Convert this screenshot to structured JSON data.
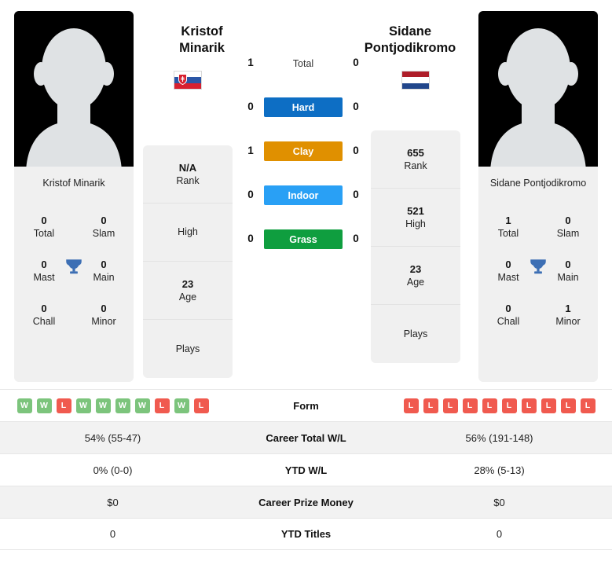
{
  "players": {
    "left": {
      "first_name": "Kristof",
      "last_name": "Minarik",
      "full_name": "Kristof Minarik",
      "photo_caption": "Kristof Minarik",
      "flag_name": "slovakia-flag",
      "flag_colors": [
        "#ffffff",
        "#2b56a6",
        "#d7202f"
      ],
      "trophies": {
        "total_value": "0",
        "total_label": "Total",
        "slam_value": "0",
        "slam_label": "Slam",
        "mast_value": "0",
        "mast_label": "Mast",
        "main_value": "0",
        "main_label": "Main",
        "chall_value": "0",
        "chall_label": "Chall",
        "minor_value": "0",
        "minor_label": "Minor"
      },
      "info": [
        {
          "value": "N/A",
          "label": "Rank"
        },
        {
          "value": "",
          "label": "High"
        },
        {
          "value": "23",
          "label": "Age"
        },
        {
          "value": "",
          "label": "Plays"
        }
      ],
      "form": [
        "W",
        "W",
        "L",
        "W",
        "W",
        "W",
        "W",
        "L",
        "W",
        "L"
      ],
      "career_total_wl": "54% (55-47)",
      "ytd_wl": "0% (0-0)",
      "career_prize_money": "$0",
      "ytd_titles": "0"
    },
    "right": {
      "first_name": "Sidane",
      "last_name": "Pontjodikromo",
      "full_name": "Sidane Pontjodikromo",
      "photo_caption": "Sidane Pontjodikromo",
      "flag_name": "netherlands-flag",
      "flag_colors": [
        "#ae1c28",
        "#ffffff",
        "#21468b"
      ],
      "trophies": {
        "total_value": "1",
        "total_label": "Total",
        "slam_value": "0",
        "slam_label": "Slam",
        "mast_value": "0",
        "mast_label": "Mast",
        "main_value": "0",
        "main_label": "Main",
        "chall_value": "0",
        "chall_label": "Chall",
        "minor_value": "1",
        "minor_label": "Minor"
      },
      "info": [
        {
          "value": "655",
          "label": "Rank"
        },
        {
          "value": "521",
          "label": "High"
        },
        {
          "value": "23",
          "label": "Age"
        },
        {
          "value": "",
          "label": "Plays"
        }
      ],
      "form": [
        "L",
        "L",
        "L",
        "L",
        "L",
        "L",
        "L",
        "L",
        "L",
        "L"
      ],
      "career_total_wl": "56% (191-148)",
      "ytd_wl": "28% (5-13)",
      "career_prize_money": "$0",
      "ytd_titles": "0"
    }
  },
  "head_to_head": {
    "rows": [
      {
        "label": "Total",
        "left": "1",
        "right": "0",
        "badge": false,
        "color": ""
      },
      {
        "label": "Hard",
        "left": "0",
        "right": "0",
        "badge": true,
        "color": "#0d6ec4"
      },
      {
        "label": "Clay",
        "left": "1",
        "right": "0",
        "badge": true,
        "color": "#e09000"
      },
      {
        "label": "Indoor",
        "left": "0",
        "right": "0",
        "badge": true,
        "color": "#29a0f5"
      },
      {
        "label": "Grass",
        "left": "0",
        "right": "0",
        "badge": true,
        "color": "#0f9e3f"
      }
    ]
  },
  "comparison": {
    "form_label": "Form",
    "rows": [
      {
        "label": "Career Total W/L",
        "left": "54% (55-47)",
        "right": "56% (191-148)"
      },
      {
        "label": "YTD W/L",
        "left": "0% (0-0)",
        "right": "28% (5-13)"
      },
      {
        "label": "Career Prize Money",
        "left": "$0",
        "right": "$0"
      },
      {
        "label": "YTD Titles",
        "left": "0",
        "right": "0"
      }
    ]
  },
  "theme": {
    "card_bg": "#f0f0f0",
    "row_alt_bg": "#f2f2f2",
    "win_color": "#7cc47c",
    "loss_color": "#f05a4f",
    "trophy_color": "#3d6fb4"
  }
}
